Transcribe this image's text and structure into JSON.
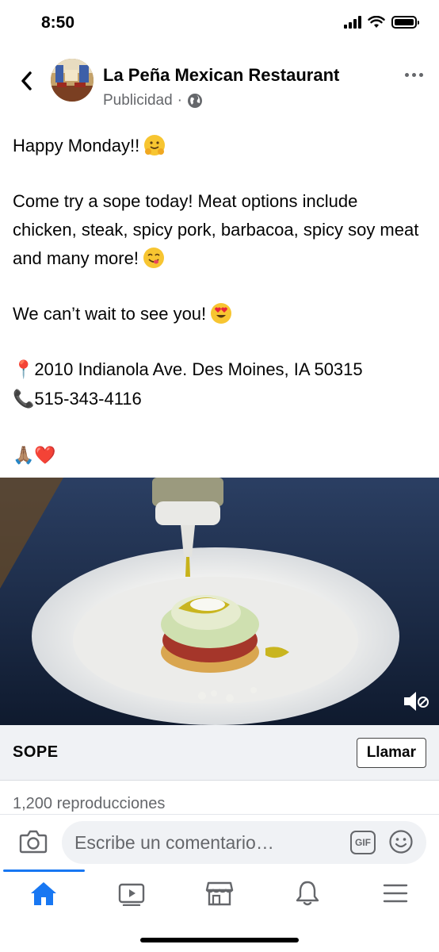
{
  "status_bar": {
    "time": "8:50",
    "signal_icon": "cellular-signal-icon",
    "wifi_icon": "wifi-icon",
    "battery_icon": "battery-icon"
  },
  "post": {
    "page_name": "La Peña Mexican Restaurant",
    "sponsored_label": "Publicidad",
    "separator": "·",
    "privacy_icon": "globe-icon",
    "text": {
      "line1": "Happy Monday!!",
      "line2": "Come try a sope today! Meat options include chicken, steak, spicy pork, barbacoa, spicy soy meat and many more!",
      "line3": "We can’t wait to see you!",
      "address": "2010 Indianola Ave. Des Moines, IA 50315",
      "phone": "515-343-4116"
    },
    "emojis": {
      "hug": "hugging-face-emoji",
      "yum": "yum-face-emoji",
      "heart_eyes": "heart-eyes-emoji",
      "pin": "📍",
      "phone": "📞",
      "pray": "🙏🏽",
      "heart": "❤️"
    }
  },
  "cta": {
    "title": "SOPE",
    "button_label": "Llamar"
  },
  "views_text": "1,200 reproducciones",
  "comment_bar": {
    "placeholder": "Escribe un comentario…",
    "gif_label": "GIF"
  },
  "tabs": [
    {
      "name": "home-icon",
      "active": true
    },
    {
      "name": "video-icon",
      "active": false
    },
    {
      "name": "marketplace-icon",
      "active": false
    },
    {
      "name": "notifications-icon",
      "active": false
    },
    {
      "name": "menu-icon",
      "active": false
    }
  ],
  "colors": {
    "accent": "#1877f2",
    "secondary_text": "#65676b",
    "cta_background": "#f0f2f5"
  }
}
